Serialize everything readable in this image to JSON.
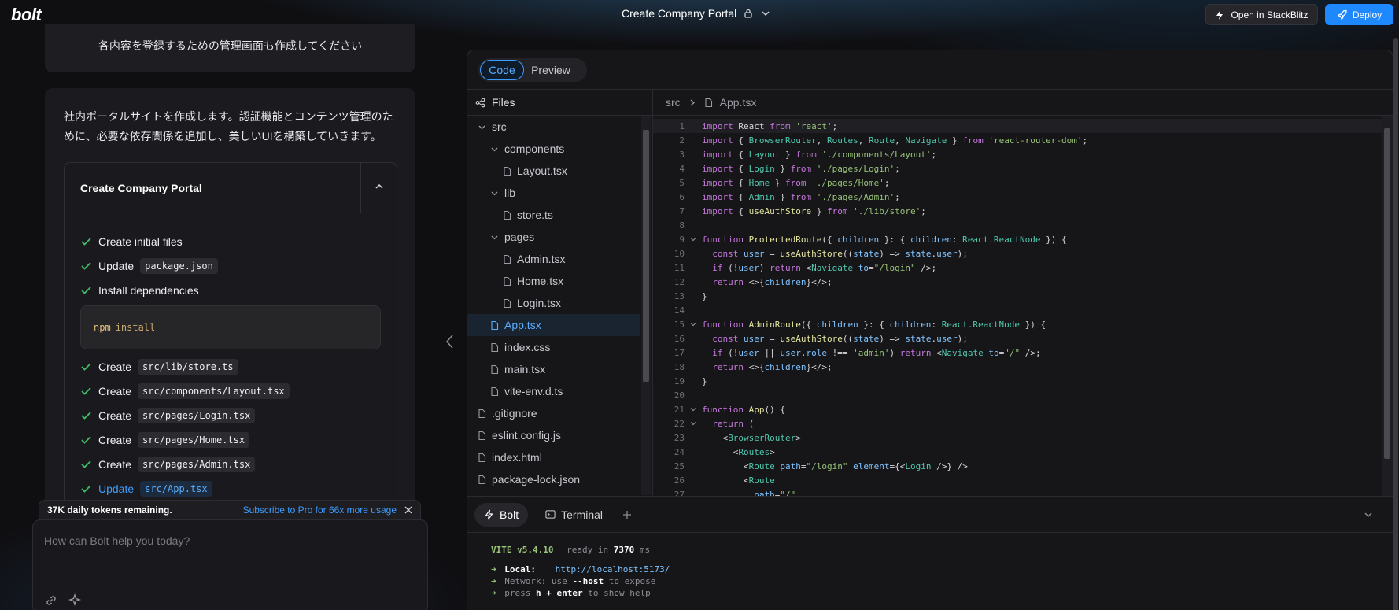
{
  "header": {
    "logo": "bolt",
    "project_title": "Create Company Portal",
    "open_stackblitz_label": "Open in StackBlitz",
    "deploy_label": "Deploy"
  },
  "chat": {
    "user_message": "各内容を登録するための管理画面も作成してください",
    "assistant_message": "社内ポータルサイトを作成します。認証機能とコンテンツ管理のために、必要な依存関係を追加し、美しいUIを構築していきます。",
    "artifact": {
      "title": "Create Company Portal",
      "steps": [
        {
          "label": "Create initial files",
          "code": ""
        },
        {
          "label": "Update",
          "code": "package.json"
        },
        {
          "label": "Install dependencies",
          "code": ""
        },
        {
          "label": "Create",
          "code": "src/lib/store.ts"
        },
        {
          "label": "Create",
          "code": "src/components/Layout.tsx"
        },
        {
          "label": "Create",
          "code": "src/pages/Login.tsx"
        },
        {
          "label": "Create",
          "code": "src/pages/Home.tsx"
        },
        {
          "label": "Create",
          "code": "src/pages/Admin.tsx"
        },
        {
          "label": "Update",
          "code": "src/App.tsx"
        }
      ],
      "command": {
        "bin": "npm",
        "arg": "install"
      }
    },
    "tokens_remaining": "37K daily tokens remaining.",
    "subscribe_link": "Subscribe to Pro for 66x more usage",
    "input_placeholder": "How can Bolt help you today?"
  },
  "workbench": {
    "tabs": {
      "code": "Code",
      "preview": "Preview"
    },
    "files_label": "Files",
    "tree": [
      {
        "name": "src",
        "type": "folder",
        "depth": 0
      },
      {
        "name": "components",
        "type": "folder",
        "depth": 1
      },
      {
        "name": "Layout.tsx",
        "type": "file",
        "depth": 2
      },
      {
        "name": "lib",
        "type": "folder",
        "depth": 1
      },
      {
        "name": "store.ts",
        "type": "file",
        "depth": 2
      },
      {
        "name": "pages",
        "type": "folder",
        "depth": 1
      },
      {
        "name": "Admin.tsx",
        "type": "file",
        "depth": 2
      },
      {
        "name": "Home.tsx",
        "type": "file",
        "depth": 2
      },
      {
        "name": "Login.tsx",
        "type": "file",
        "depth": 2
      },
      {
        "name": "App.tsx",
        "type": "file",
        "depth": 1,
        "selected": true
      },
      {
        "name": "index.css",
        "type": "file",
        "depth": 1
      },
      {
        "name": "main.tsx",
        "type": "file",
        "depth": 1
      },
      {
        "name": "vite-env.d.ts",
        "type": "file",
        "depth": 1
      },
      {
        "name": ".gitignore",
        "type": "file",
        "depth": 0
      },
      {
        "name": "eslint.config.js",
        "type": "file",
        "depth": 0
      },
      {
        "name": "index.html",
        "type": "file",
        "depth": 0
      },
      {
        "name": "package-lock.json",
        "type": "file",
        "depth": 0
      }
    ],
    "breadcrumb": {
      "folder": "src",
      "file": "App.tsx"
    },
    "code_lines": [
      "import React from 'react';",
      "import { BrowserRouter, Routes, Route, Navigate } from 'react-router-dom';",
      "import { Layout } from './components/Layout';",
      "import { Login } from './pages/Login';",
      "import { Home } from './pages/Home';",
      "import { Admin } from './pages/Admin';",
      "import { useAuthStore } from './lib/store';",
      "",
      "function ProtectedRoute({ children }: { children: React.ReactNode }) {",
      "  const user = useAuthStore((state) => state.user);",
      "  if (!user) return <Navigate to=\"/login\" />;",
      "  return <>{children}</>;",
      "}",
      "",
      "function AdminRoute({ children }: { children: React.ReactNode }) {",
      "  const user = useAuthStore((state) => state.user);",
      "  if (!user || user.role !== 'admin') return <Navigate to=\"/\" />;",
      "  return <>{children}</>;",
      "}",
      "",
      "function App() {",
      "  return (",
      "    <BrowserRouter>",
      "      <Routes>",
      "        <Route path=\"/login\" element={<Login />} />",
      "        <Route",
      "          path=\"/\""
    ],
    "fold_lines": [
      9,
      15,
      21,
      22
    ],
    "terminal_tabs": {
      "bolt": "Bolt",
      "terminal": "Terminal"
    },
    "terminal": {
      "vite": "VITE v5.4.10",
      "ready": "ready in",
      "ms": "7370",
      "ms_unit": "ms",
      "local_label": "Local:",
      "local_url": "http://localhost:5173/",
      "network": "Network: use",
      "network_flag": "--host",
      "network_tail": "to expose",
      "press": "press",
      "press_keys": "h + enter",
      "press_tail": "to show help"
    }
  },
  "colors": {
    "accent": "#1e88ff",
    "success": "#3fbf6a"
  }
}
